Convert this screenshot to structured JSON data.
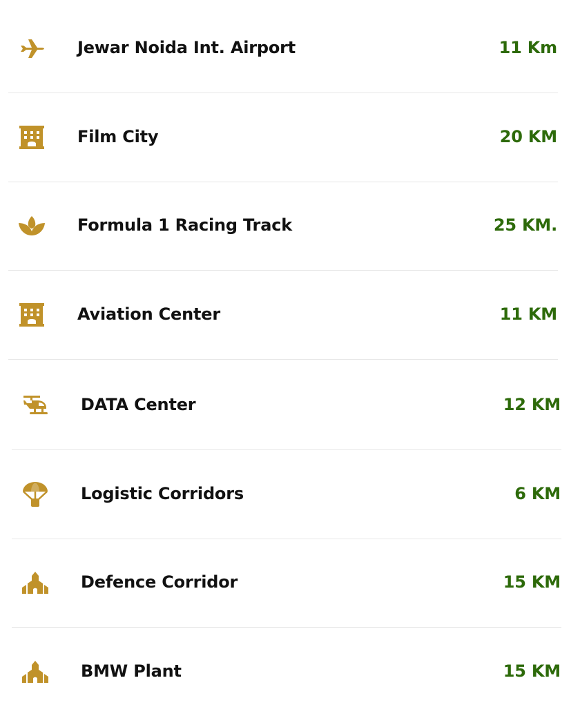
{
  "colors": {
    "icon": "#c0922a",
    "label": "#111111",
    "distance": "#2d6a0a",
    "divider": "#e6e6e6"
  },
  "places": [
    {
      "icon": "plane-icon",
      "label": "Jewar Noida Int. Airport",
      "distance": "11 Km"
    },
    {
      "icon": "building-icon",
      "label": "Film City",
      "distance": "20 KM"
    },
    {
      "icon": "spa-icon",
      "label": "Formula 1 Racing Track",
      "distance": "25 KM."
    },
    {
      "icon": "building-icon",
      "label": "Aviation Center",
      "distance": "11 KM"
    },
    {
      "icon": "helicopter-icon",
      "label": "DATA Center",
      "distance": "12 KM"
    },
    {
      "icon": "parachute-box-icon",
      "label": "Logistic Corridors",
      "distance": "6 KM"
    },
    {
      "icon": "place-of-worship-icon",
      "label": "Defence Corridor",
      "distance": "15 KM"
    },
    {
      "icon": "place-of-worship-icon",
      "label": "BMW Plant",
      "distance": "15 KM"
    }
  ]
}
